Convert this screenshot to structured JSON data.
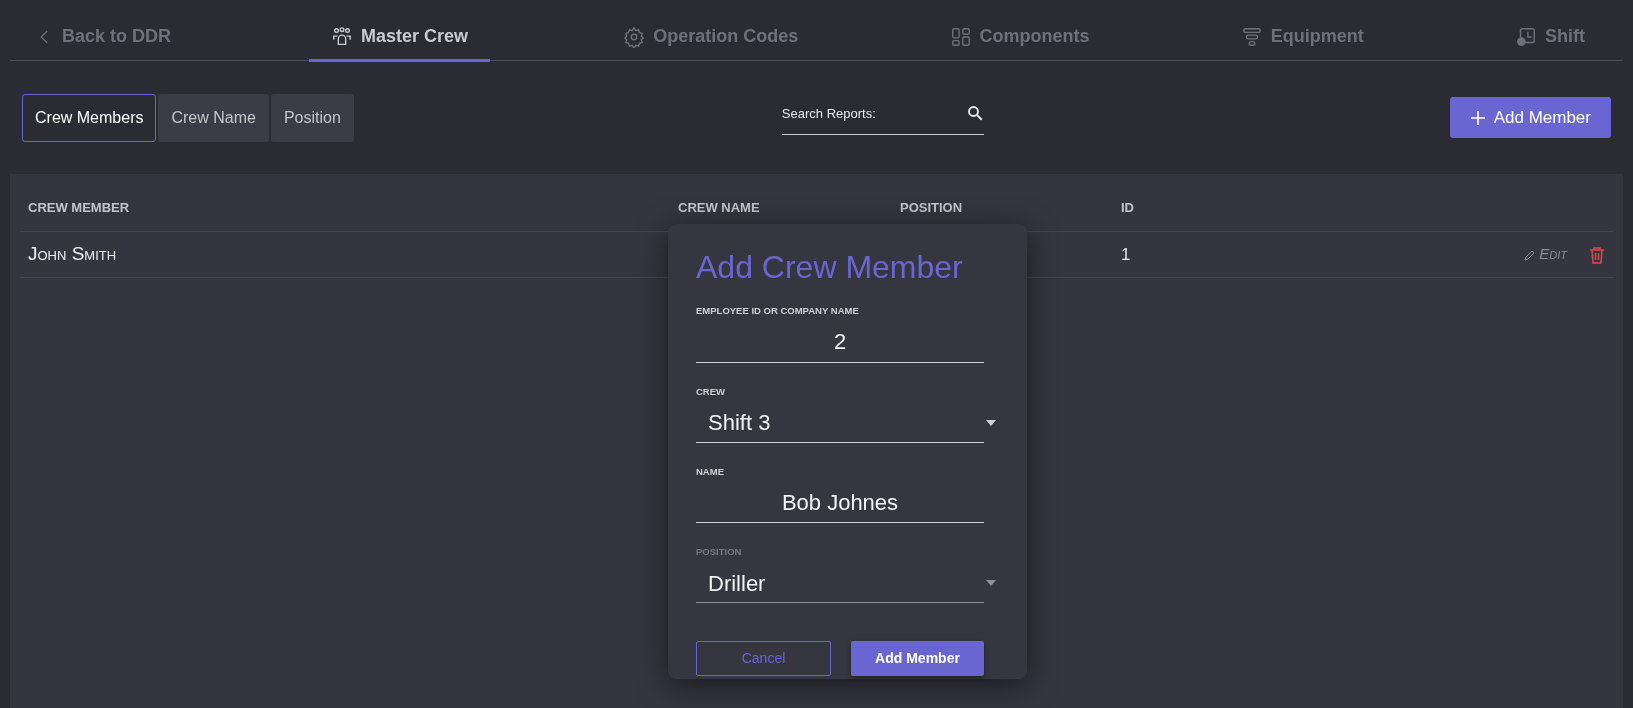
{
  "nav": {
    "back": {
      "label": "Back to DDR"
    },
    "tabs": [
      {
        "label": "Master Crew",
        "selected": true
      },
      {
        "label": "Operation Codes",
        "selected": false
      },
      {
        "label": "Components",
        "selected": false
      },
      {
        "label": "Equipment",
        "selected": false
      },
      {
        "label": "Shift",
        "selected": false
      }
    ]
  },
  "subtabs": [
    {
      "label": "Crew Members",
      "selected": true
    },
    {
      "label": "Crew Name",
      "selected": false
    },
    {
      "label": "Position",
      "selected": false
    }
  ],
  "search": {
    "label": "Search Reports:"
  },
  "add_button": {
    "label": "Add Member"
  },
  "table": {
    "columns": [
      "CREW MEMBER",
      "CREW NAME",
      "POSITION",
      "ID"
    ],
    "rows": [
      {
        "crew_member": "John Smith",
        "id": "1",
        "edit": "Edit"
      }
    ]
  },
  "modal": {
    "title": "Add Crew Member",
    "fields": [
      {
        "kind": "text",
        "label": "EMPLOYEE ID OR COMPANY NAME",
        "value": "2",
        "disabled": false
      },
      {
        "kind": "select",
        "label": "CREW",
        "value": "Shift 3",
        "disabled": false
      },
      {
        "kind": "text",
        "label": "NAME",
        "value": "Bob Johnes",
        "disabled": false
      },
      {
        "kind": "select",
        "label": "POSITION",
        "value": "Driller",
        "disabled": true
      }
    ],
    "buttons": [
      {
        "kind": "outline",
        "label": "Cancel"
      },
      {
        "kind": "primary",
        "label": "Add Member"
      }
    ]
  }
}
